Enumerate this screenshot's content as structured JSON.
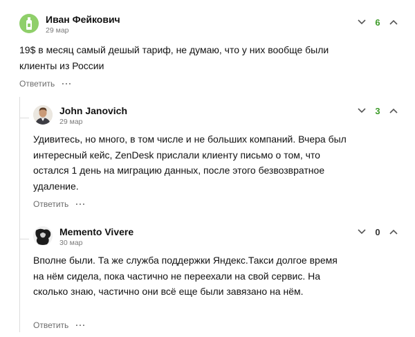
{
  "colors": {
    "positive_score": "#3d9b29",
    "neutral_score": "#333333",
    "avatar_bg_ivan": "#8fcf6a",
    "thread_line": "#dcdcdc"
  },
  "comments": [
    {
      "author": "Иван Фейкович",
      "date": "29 мар",
      "text": "19$ в месяц самый дешый тариф, не думаю, что у них вообще были клиенты из России",
      "score": "6",
      "reply_label": "Ответить",
      "more_label": "···",
      "avatar_icon": "bottle-icon"
    },
    {
      "author": "John Janovich",
      "date": "29 мар",
      "text": "Удивитесь, но много, в том числе и не больших компаний. Вчера был интересный кейс, ZenDesk прислали клиенту письмо о том, что остался 1 день на миграцию данных, после этого безвозвратное удаление.",
      "score": "3",
      "reply_label": "Ответить",
      "more_label": "···",
      "avatar_icon": "person-photo-icon"
    },
    {
      "author": "Memento Vivere",
      "date": "30 мар",
      "text": "Вполне были. Та же служба поддержки Яндекс.Такси долгое время на нём сидела, пока частично не переехали на свой сервис. На сколько знаю, частично они всё еще были завязано на нём.",
      "score": "0",
      "reply_label": "Ответить",
      "more_label": "···",
      "avatar_icon": "dark-figure-icon"
    }
  ]
}
